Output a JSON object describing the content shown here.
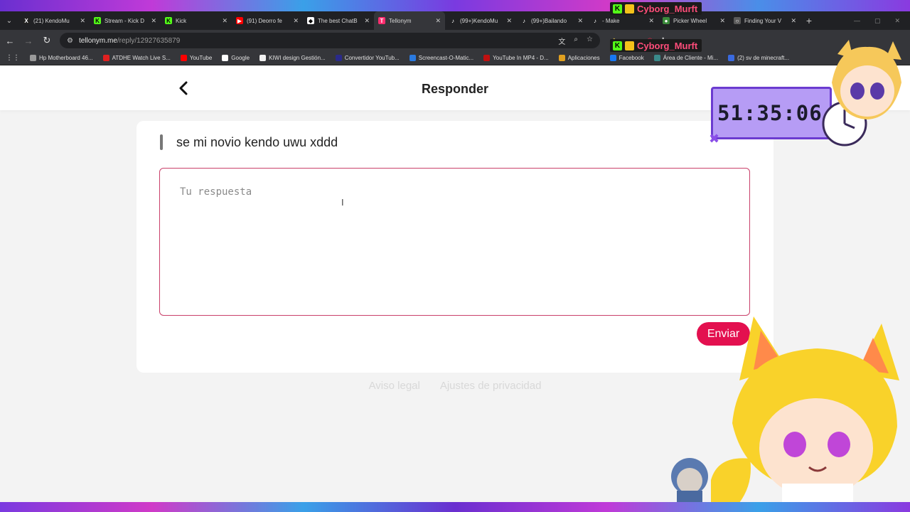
{
  "browser": {
    "tabs": [
      {
        "title": "(21) KendoMu",
        "fav": "X",
        "fav_color": "#222222",
        "active": false
      },
      {
        "title": "Stream - Kick D",
        "fav": "K",
        "fav_color": "#53fc18",
        "active": false
      },
      {
        "title": "Kick",
        "fav": "K",
        "fav_color": "#53fc18",
        "active": false
      },
      {
        "title": "(91) Deorro fe",
        "fav": "▶",
        "fav_color": "#ff0000",
        "active": false
      },
      {
        "title": "The best ChatB",
        "fav": "◆",
        "fav_color": "#ffffff",
        "active": false
      },
      {
        "title": "Tellonym",
        "fav": "T",
        "fav_color": "#ff2d6f",
        "active": true
      },
      {
        "title": "(99+)KendoMu",
        "fav": "♪",
        "fav_color": "#202124",
        "active": false
      },
      {
        "title": "(99+)Bailando",
        "fav": "♪",
        "fav_color": "#202124",
        "active": false
      },
      {
        "title": "- Make",
        "fav": "♪",
        "fav_color": "#202124",
        "active": false
      },
      {
        "title": "Picker Wheel",
        "fav": "●",
        "fav_color": "#3a8a3a",
        "active": false
      },
      {
        "title": "Finding Your V",
        "fav": "○",
        "fav_color": "#5a5a5a",
        "active": false
      }
    ],
    "url_host": "tellonym.me",
    "url_path": "/reply/12927635879",
    "bookmarks": [
      {
        "label": "Hp Motherboard 46...",
        "color": "#9a9a9a"
      },
      {
        "label": "ATDHE Watch Live S...",
        "color": "#e02020"
      },
      {
        "label": "YouTube",
        "color": "#ff0000"
      },
      {
        "label": "Google",
        "color": "#ffffff"
      },
      {
        "label": "KIWI design Gestión...",
        "color": "#f0f0f0"
      },
      {
        "label": "Convertidor YouTub...",
        "color": "#2a2a8a"
      },
      {
        "label": "Screencast-O-Matic...",
        "color": "#2a7ae0"
      },
      {
        "label": "YouTube In MP4 - D...",
        "color": "#c01010"
      },
      {
        "label": "Aplicaciones",
        "color": "#e0a020"
      },
      {
        "label": "Facebook",
        "color": "#1877f2"
      },
      {
        "label": "Área de Cliente - Mi...",
        "color": "#3a8a8a"
      },
      {
        "label": "(2) sv de minecraft...",
        "color": "#3a6ae0"
      }
    ]
  },
  "overlay": {
    "chat_user_1": "Cyborg_Murft",
    "chat_user_2": "Cyborg_Murft",
    "timer": "51:35:06"
  },
  "page": {
    "title": "Responder",
    "question": "se mi novio kendo uwu xddd",
    "answer_placeholder": "Tu respuesta",
    "send_label": "Enviar",
    "footer": [
      "Aviso legal",
      "Ajustes de privacidad"
    ]
  },
  "colors": {
    "accent": "#e3104f",
    "answer_border": "#c9406a",
    "chrome_dark": "#202124",
    "chrome_mid": "#35363a"
  }
}
